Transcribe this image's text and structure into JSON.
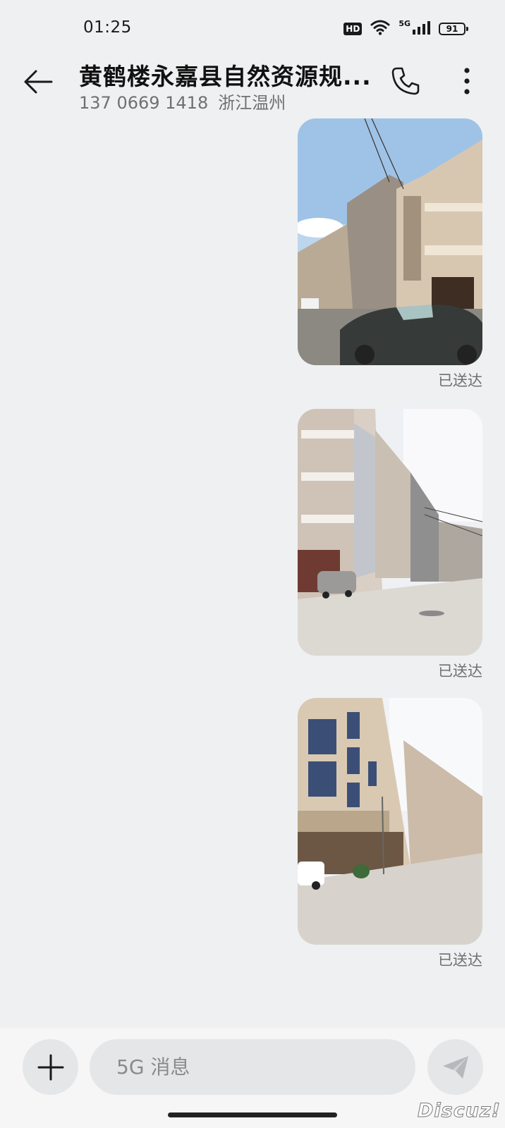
{
  "status_bar": {
    "time": "01:25",
    "hd": "HD",
    "network": "5G",
    "battery": "91",
    "icons": [
      "hd-icon",
      "wifi-icon",
      "signal-icon",
      "battery-icon"
    ]
  },
  "header": {
    "contact_name": "黄鹤楼永嘉县自然资源规...",
    "phone_number": "137 0669 1418",
    "location": "浙江温州",
    "back_icon": "arrow-left-icon",
    "call_icon": "phone-icon",
    "more_icon": "more-vertical-icon"
  },
  "messages": [
    {
      "type": "image",
      "subject": "street with multi-storey buildings and parked car",
      "status": "已送达"
    },
    {
      "type": "image",
      "subject": "street with balconied buildings and parked car",
      "status": "已送达"
    },
    {
      "type": "image",
      "subject": "long street lined with buildings",
      "status": "已送达"
    }
  ],
  "composer": {
    "placeholder": "5G 消息",
    "value": "",
    "add_icon": "plus-icon",
    "send_icon": "send-icon"
  },
  "watermark": "Discuz!",
  "colors": {
    "background": "#eff0f2",
    "composer_bg": "#f6f6f7",
    "button_bg": "#e5e6e8",
    "secondary_text": "#707070"
  }
}
